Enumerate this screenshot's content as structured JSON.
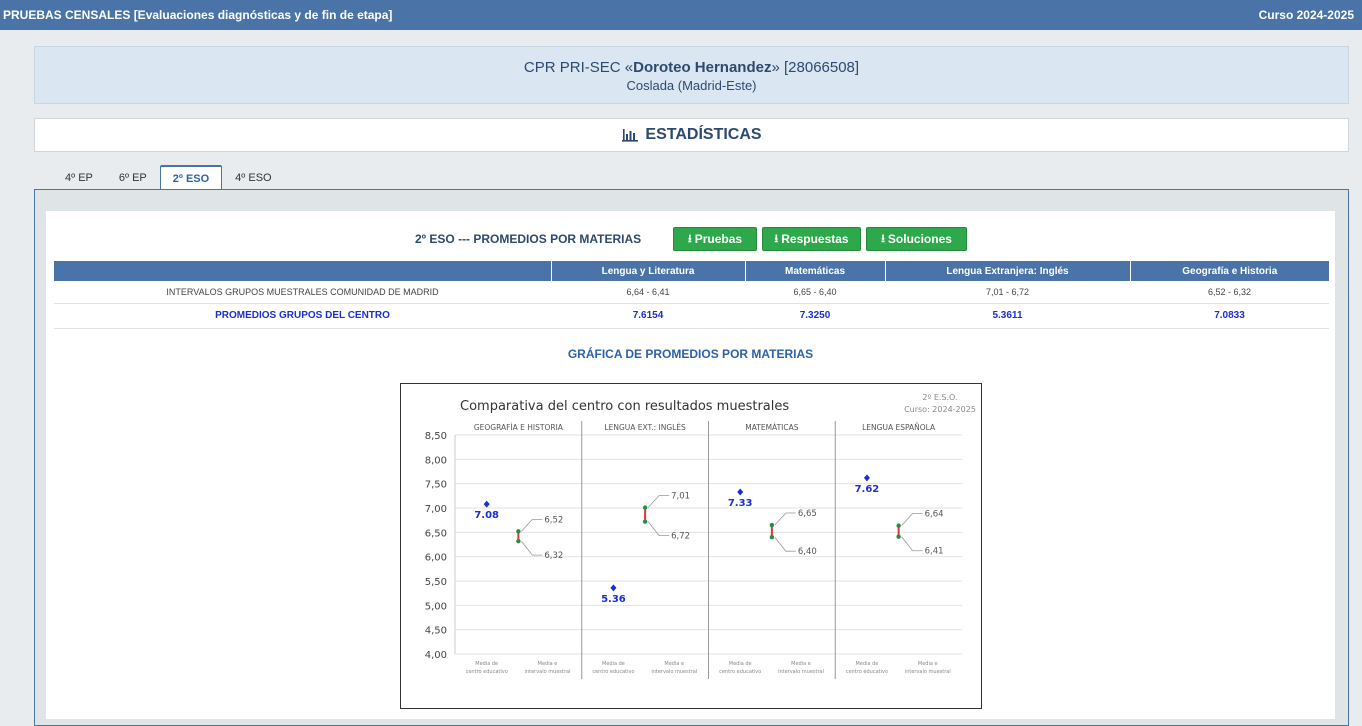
{
  "topbar": {
    "title": "PRUEBAS CENSALES [Evaluaciones diagnósticas y de fin de etapa]",
    "course": "Curso 2024-2025"
  },
  "school": {
    "prefix": "CPR PRI-SEC «",
    "name": "Doroteo Hernandez",
    "suffix": "» [28066508]",
    "location": "Coslada (Madrid-Este)"
  },
  "stats": {
    "title": "ESTADÍSTICAS",
    "icon": "bar-chart-icon"
  },
  "tabs": [
    {
      "label": "4º EP",
      "active": false
    },
    {
      "label": "6º EP",
      "active": false
    },
    {
      "label": "2º ESO",
      "active": true
    },
    {
      "label": "4º ESO",
      "active": false
    }
  ],
  "panel": {
    "title": "2º ESO --- PROMEDIOS POR MATERIAS",
    "buttons": {
      "pruebas": "Pruebas",
      "respuestas": "Respuestas",
      "soluciones": "Soluciones"
    },
    "download_icon": "download-icon",
    "button_color": "#2da84a"
  },
  "table": {
    "columns": [
      "",
      "Lengua y Literatura",
      "Matemáticas",
      "Lengua Extranjera: Inglés",
      "Geografía e Historia"
    ],
    "rows": [
      [
        "INTERVALOS GRUPOS MUESTRALES COMUNIDAD DE MADRID",
        "6,64 - 6,41",
        "6,65 - 6,40",
        "7,01 - 6,72",
        "6,52 - 6,32"
      ],
      [
        "PROMEDIOS GRUPOS DEL CENTRO",
        "7.6154",
        "7.3250",
        "5.3611",
        "7.0833"
      ]
    ]
  },
  "chart_title": "GRÁFICA DE PROMEDIOS POR MATERIAS",
  "chart_data": {
    "type": "scatter",
    "title": "Comparativa del centro con resultados muestrales",
    "subtitle_line1": "2º E.S.O.",
    "subtitle_line2": "Curso: 2024-2025",
    "ylim": [
      4.0,
      8.5
    ],
    "yticks": [
      "4,00",
      "4,50",
      "5,00",
      "5,50",
      "6,00",
      "6,50",
      "7,00",
      "7,50",
      "8,00",
      "8,50"
    ],
    "x_sub_labels": [
      "Media de centro educativo",
      "Media e intervalo muestral"
    ],
    "groups": [
      {
        "name": "GEOGRAFÍA E HISTORIA",
        "center": 7.08,
        "center_label": "7.08",
        "interval": [
          6.32,
          6.52
        ],
        "high_label": "6,52",
        "low_label": "6,32"
      },
      {
        "name": "LENGUA EXT.: INGLÉS",
        "center": 5.36,
        "center_label": "5.36",
        "interval": [
          6.72,
          7.01
        ],
        "high_label": "7,01",
        "low_label": "6,72"
      },
      {
        "name": "MATEMÁTICAS",
        "center": 7.33,
        "center_label": "7.33",
        "interval": [
          6.4,
          6.65
        ],
        "high_label": "6,65",
        "low_label": "6,40"
      },
      {
        "name": "LENGUA ESPAÑOLA",
        "center": 7.62,
        "center_label": "7.62",
        "interval": [
          6.41,
          6.64
        ],
        "high_label": "6,64",
        "low_label": "6,41"
      }
    ],
    "grid": true,
    "colors": {
      "center_point": "#1a2fd4",
      "interval_bar": "#d23a3a",
      "interval_end": "#2a8a4a"
    }
  }
}
